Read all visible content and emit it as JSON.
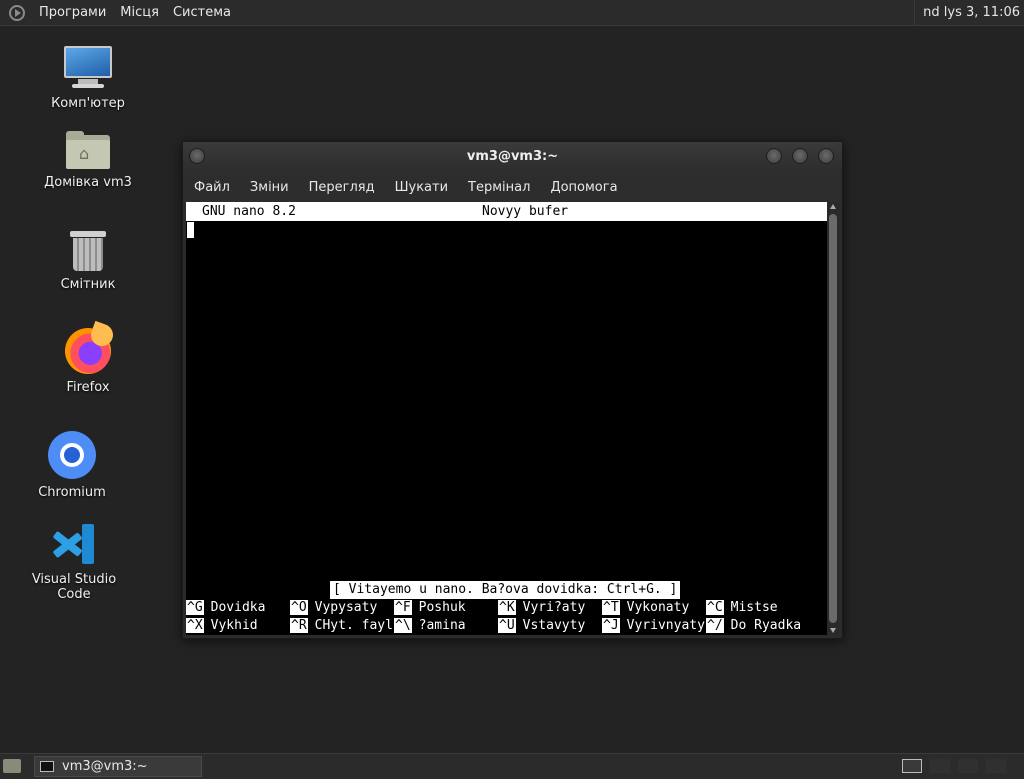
{
  "top_panel": {
    "menu": [
      "Програми",
      "Місця",
      "Система"
    ],
    "clock": "nd lys 3, 11:06"
  },
  "desktop_icons": [
    {
      "label": "Комп'ютер",
      "icon": "computer-icon"
    },
    {
      "label": "Домівка vm3",
      "icon": "home-folder-icon"
    },
    {
      "label": "Смітник",
      "icon": "trash-icon"
    },
    {
      "label": "Firefox",
      "icon": "firefox-icon"
    },
    {
      "label": "Chromium",
      "icon": "chromium-icon"
    },
    {
      "label": "Visual Studio Code",
      "icon": "vscode-icon"
    }
  ],
  "terminal_window": {
    "title": "vm3@vm3:~",
    "menu": [
      "Файл",
      "Зміни",
      "Перегляд",
      "Шукати",
      "Термінал",
      "Допомога"
    ],
    "nano": {
      "version": "GNU nano 8.2",
      "buffer": "Novyy bufer",
      "status": "[ Vitayemo u nano. Ba?ova dovidka: Ctrl+G. ]",
      "shortcuts_row1": [
        {
          "key": "^G",
          "label": "Dovidka"
        },
        {
          "key": "^O",
          "label": "Vypysaty"
        },
        {
          "key": "^F",
          "label": "Poshuk"
        },
        {
          "key": "^K",
          "label": "Vyri?aty"
        },
        {
          "key": "^T",
          "label": "Vykonaty"
        },
        {
          "key": "^C",
          "label": "Mistse"
        }
      ],
      "shortcuts_row2": [
        {
          "key": "^X",
          "label": "Vykhid"
        },
        {
          "key": "^R",
          "label": "CHyt. fayl"
        },
        {
          "key": "^\\",
          "label": "?amina"
        },
        {
          "key": "^U",
          "label": "Vstavyty"
        },
        {
          "key": "^J",
          "label": "Vyrivnyaty"
        },
        {
          "key": "^/",
          "label": "Do Ryadka"
        }
      ]
    }
  },
  "taskbar": {
    "task_label": "vm3@vm3:~"
  },
  "colors": {
    "desktop_bg": "#232323",
    "panel_bg": "#2b2b2b",
    "terminal_bg": "#000000"
  }
}
